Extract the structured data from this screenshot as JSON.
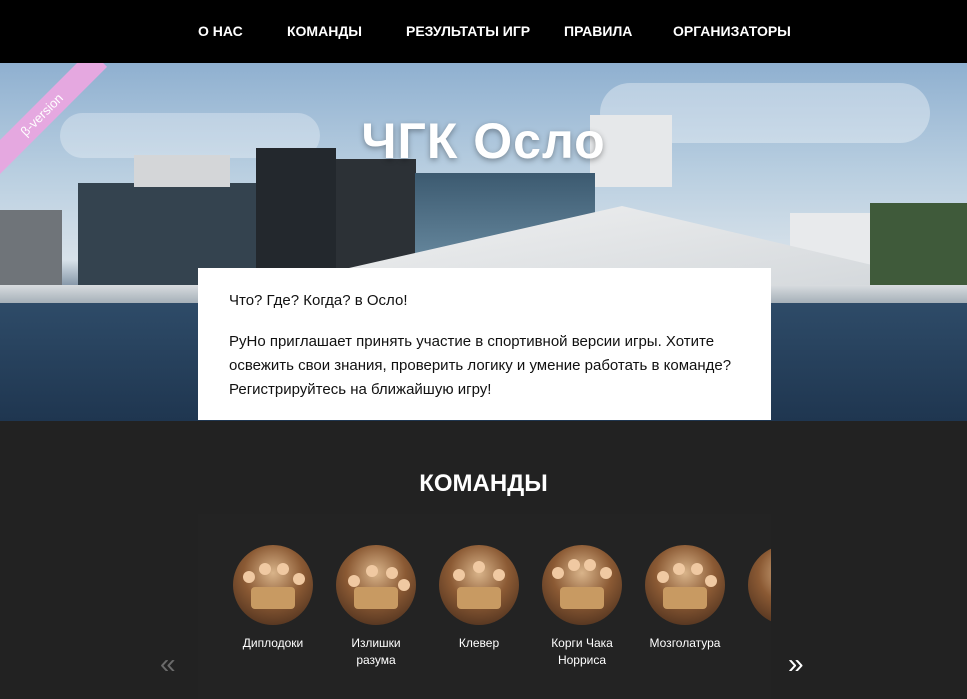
{
  "nav": {
    "items": [
      "О НАС",
      "КОМАНДЫ",
      "РЕЗУЛЬТАТЫ ИГР",
      "ПРАВИЛА",
      "ОРГАНИЗАТОРЫ"
    ]
  },
  "hero": {
    "title": "ЧГК Осло",
    "badge": "β-version"
  },
  "intro": {
    "line1": "Что? Где? Когда? в Осло!",
    "line2": "PyHo приглашает принять участие в спортивной версии игры. Хотите освежить свои знания, проверить логику и умение работать в команде? Регистрируйтесь на ближайшую игру!"
  },
  "teams": {
    "title": "КОМАНДЫ",
    "items": [
      {
        "name": "Диплодоки"
      },
      {
        "name": "Излишки разума"
      },
      {
        "name": "Клевер"
      },
      {
        "name": "Корги Чака Норриса"
      },
      {
        "name": "Мозголатура"
      }
    ],
    "prev_icon": "chevron-double-left-icon",
    "next_icon": "chevron-double-right-icon"
  },
  "colors": {
    "nav_bg": "#000000",
    "page_bg": "#222222",
    "badge": "#e5a8e0"
  }
}
